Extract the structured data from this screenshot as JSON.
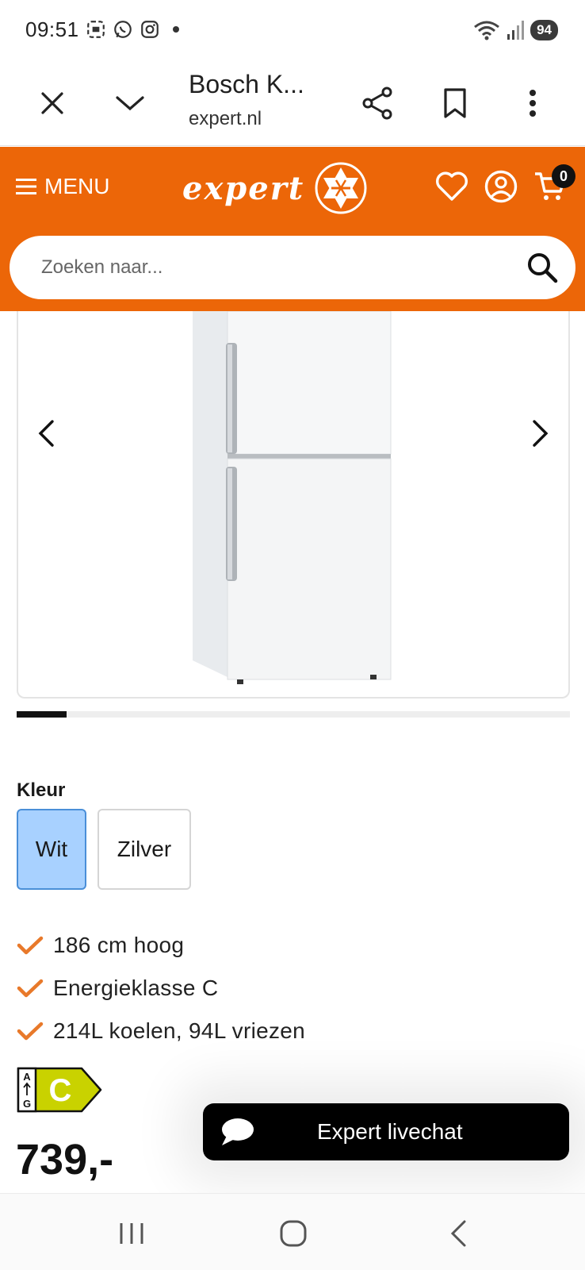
{
  "status_bar": {
    "time": "09:51",
    "battery": "94"
  },
  "browser": {
    "title": "Bosch K...",
    "url": "expert.nl"
  },
  "header": {
    "menu_label": "MENU",
    "logo_text": "expert",
    "cart_count": "0"
  },
  "search": {
    "placeholder": "Zoeken naar..."
  },
  "carousel": {
    "progress": 0.09
  },
  "product": {
    "color_label": "Kleur",
    "colors": [
      "Wit",
      "Zilver"
    ],
    "selected_color": "Wit",
    "features": [
      "186 cm hoog",
      "Energieklasse C",
      "214L koelen, 94L vriezen"
    ],
    "energy_scale_top": "A",
    "energy_scale_bottom": "G",
    "energy_class": "C",
    "price": "739,-"
  },
  "livechat": {
    "label": "Expert livechat"
  },
  "colors": {
    "brand_orange": "#ec6608",
    "check_orange": "#e8792a",
    "energy_green": "#c9d200",
    "selected_swatch": "#a8d1ff"
  }
}
